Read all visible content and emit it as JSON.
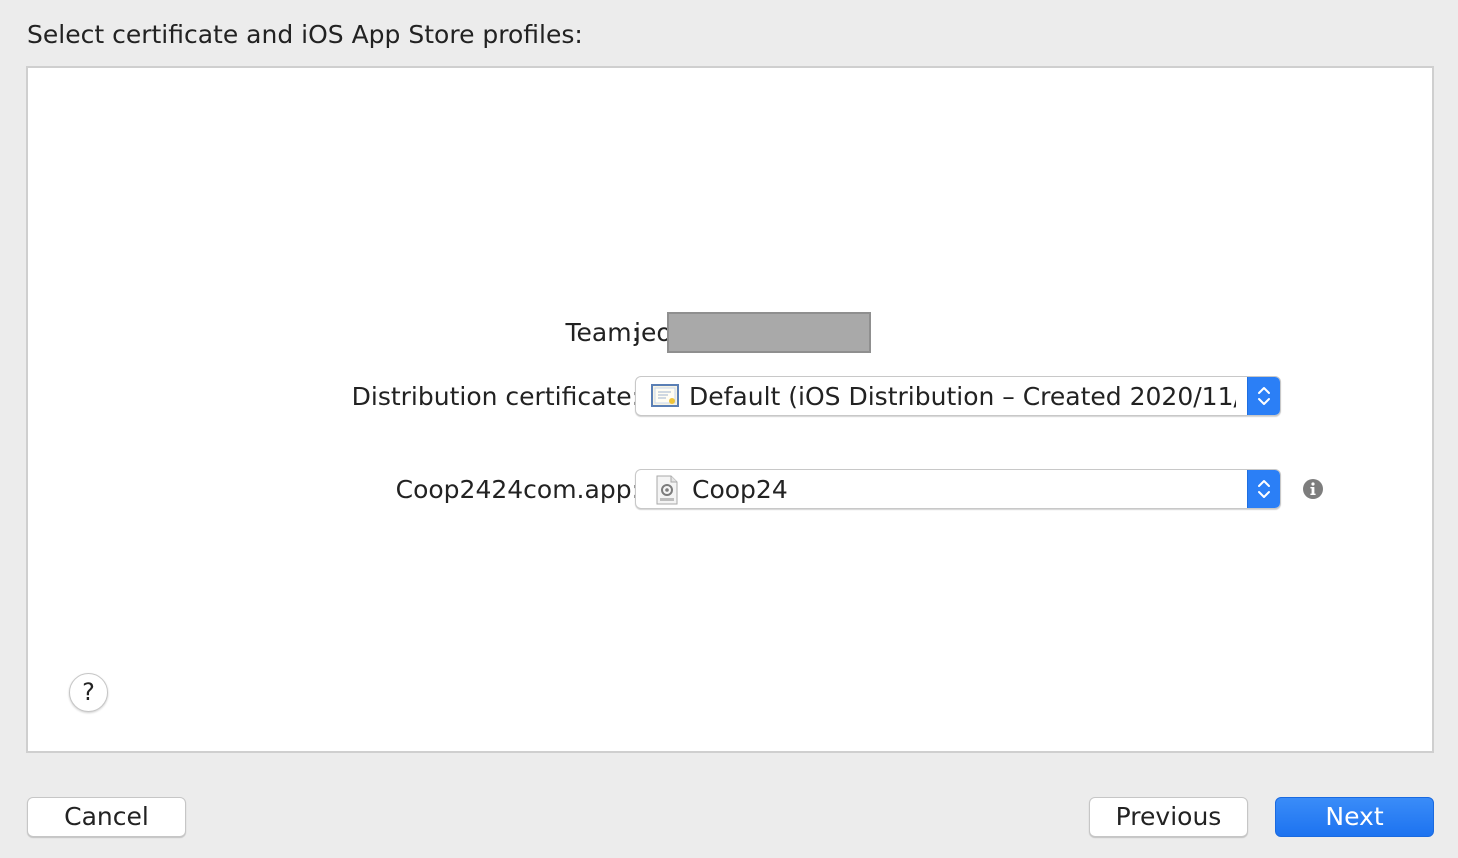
{
  "heading": "Select certificate and iOS App Store profiles:",
  "team": {
    "label": "Team:",
    "value": "jeo"
  },
  "distribution_certificate": {
    "label": "Distribution certificate:",
    "selected": "Default (iOS Distribution – Created 2020/11/...",
    "icon": "certificate-icon"
  },
  "app_profile": {
    "label": "Coop2424com.app:",
    "selected": "Coop24",
    "icon": "provisioning-profile-icon"
  },
  "help_label": "?",
  "buttons": {
    "cancel": "Cancel",
    "previous": "Previous",
    "next": "Next"
  },
  "colors": {
    "accent": "#2b7ff6",
    "background": "#ececec",
    "panel": "#ffffff"
  }
}
